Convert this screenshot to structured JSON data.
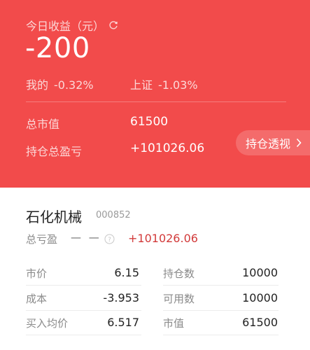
{
  "summary": {
    "today_label": "今日收益（元）",
    "today_value": "-200",
    "mine_label": "我的",
    "mine_value": "-0.32%",
    "index_label": "上证",
    "index_value": "-1.03%",
    "market_value_label": "总市值",
    "market_value": "61500",
    "total_pnl_label": "持仓总盈亏",
    "total_pnl_value": "+101026.06",
    "position_button": "持仓透视"
  },
  "stock": {
    "name": "石化机械",
    "code": "000852",
    "total_pnl_label": "总亏盈",
    "total_pnl_dash": "— —",
    "total_pnl_value": "+101026.06",
    "left": [
      {
        "label": "市价",
        "value": "6.15"
      },
      {
        "label": "成本",
        "value": "-3.953"
      },
      {
        "label": "买入均价",
        "value": "6.517"
      }
    ],
    "right": [
      {
        "label": "持仓数",
        "value": "10000"
      },
      {
        "label": "可用数",
        "value": "10000"
      },
      {
        "label": "市值",
        "value": "61500"
      }
    ]
  },
  "colors": {
    "header_bg": "#f24b4b",
    "profit_red": "#d23a3a"
  }
}
